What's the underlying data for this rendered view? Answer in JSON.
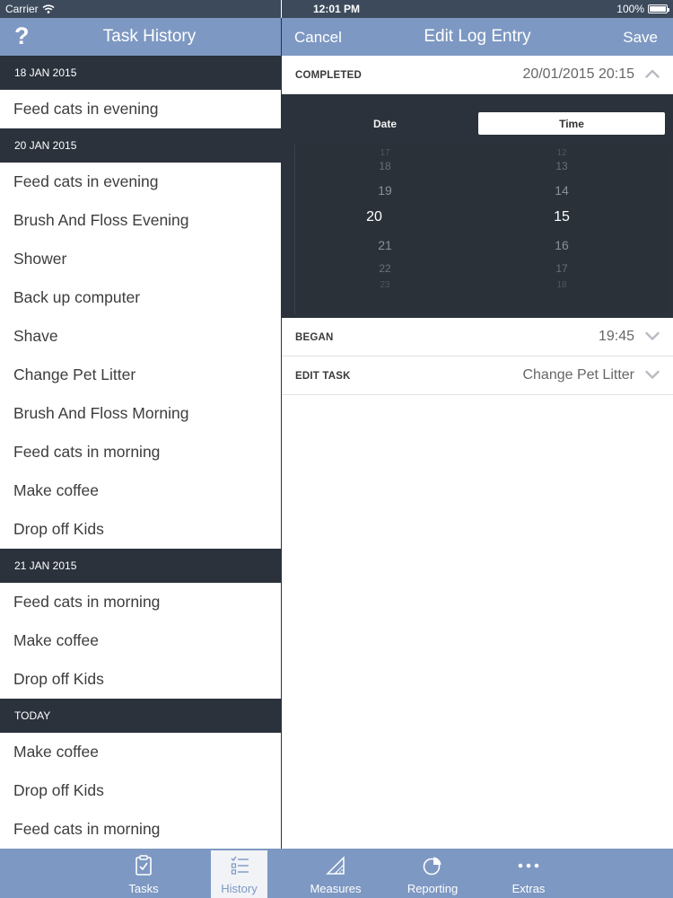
{
  "status_bar": {
    "carrier": "Carrier",
    "time": "12:01 PM",
    "battery": "100%"
  },
  "left_nav": {
    "help_glyph": "?",
    "title": "Task History"
  },
  "history": [
    {
      "date": "18 JAN 2015",
      "items": [
        "Feed cats in evening"
      ]
    },
    {
      "date": "20 JAN 2015",
      "items": [
        "Feed cats in evening",
        "Brush And Floss Evening",
        "Shower",
        "Back up computer",
        "Shave",
        "Change Pet Litter",
        "Brush And Floss Morning",
        "Feed cats in morning",
        "Make coffee",
        "Drop off Kids"
      ]
    },
    {
      "date": "21 JAN 2015",
      "items": [
        "Feed cats in morning",
        "Make coffee",
        "Drop off Kids"
      ]
    },
    {
      "date": "TODAY",
      "items": [
        "Make coffee",
        "Drop off Kids",
        "Feed cats in morning"
      ]
    }
  ],
  "right_nav": {
    "cancel": "Cancel",
    "title": "Edit Log Entry",
    "save": "Save"
  },
  "completed": {
    "label": "COMPLETED",
    "value": "20/01/2015 20:15"
  },
  "picker": {
    "segments": [
      "Date",
      "Time"
    ],
    "selected_segment": "Time",
    "hours": {
      "far_above": "17",
      "above2": "18",
      "above1": "19",
      "selected": "20",
      "below1": "21",
      "below2": "22",
      "far_below": "23"
    },
    "minutes": {
      "far_above": "12",
      "above2": "13",
      "above1": "14",
      "selected": "15",
      "below1": "16",
      "below2": "17",
      "far_below": "18"
    }
  },
  "began": {
    "label": "BEGAN",
    "value": "19:45"
  },
  "edit_task": {
    "label": "EDIT TASK",
    "value": "Change Pet Litter"
  },
  "tabs": [
    {
      "label": "Tasks",
      "icon": "clipboard-check-icon",
      "active": false
    },
    {
      "label": "History",
      "icon": "checklist-icon",
      "active": true
    },
    {
      "label": "Measures",
      "icon": "ruler-triangle-icon",
      "active": false
    },
    {
      "label": "Reporting",
      "icon": "pie-chart-icon",
      "active": false
    },
    {
      "label": "Extras",
      "icon": "more-dots-icon",
      "active": false
    }
  ],
  "colors": {
    "nav_blue": "#7d98c2",
    "dark_header": "#2b323c",
    "picker_bg": "#2c323b"
  }
}
